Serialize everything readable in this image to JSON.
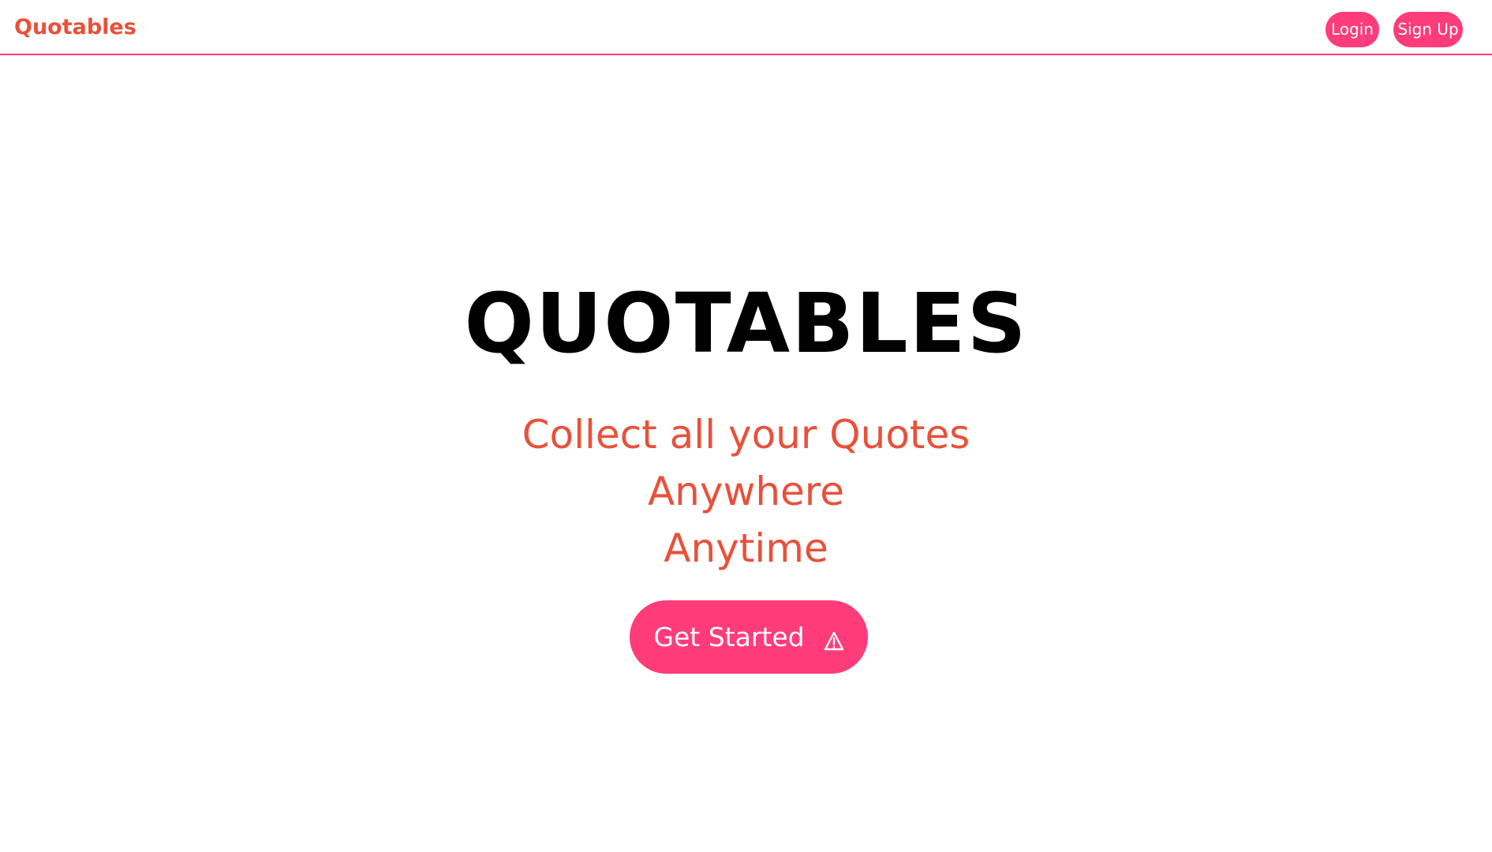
{
  "nav": {
    "brand": "Quotables",
    "login_label": "Login",
    "signup_label": "Sign Up"
  },
  "hero": {
    "title": "QUOTABLES",
    "tagline_lines": [
      "Collect all your Quotes",
      "Anywhere",
      "Anytime"
    ],
    "cta_label": "Get Started",
    "cta_icon": "warning-triangle-icon"
  },
  "colors": {
    "accent": "#ff3c7a",
    "brand_text": "#e8513a",
    "title_text": "#000000",
    "background": "#ffffff"
  }
}
